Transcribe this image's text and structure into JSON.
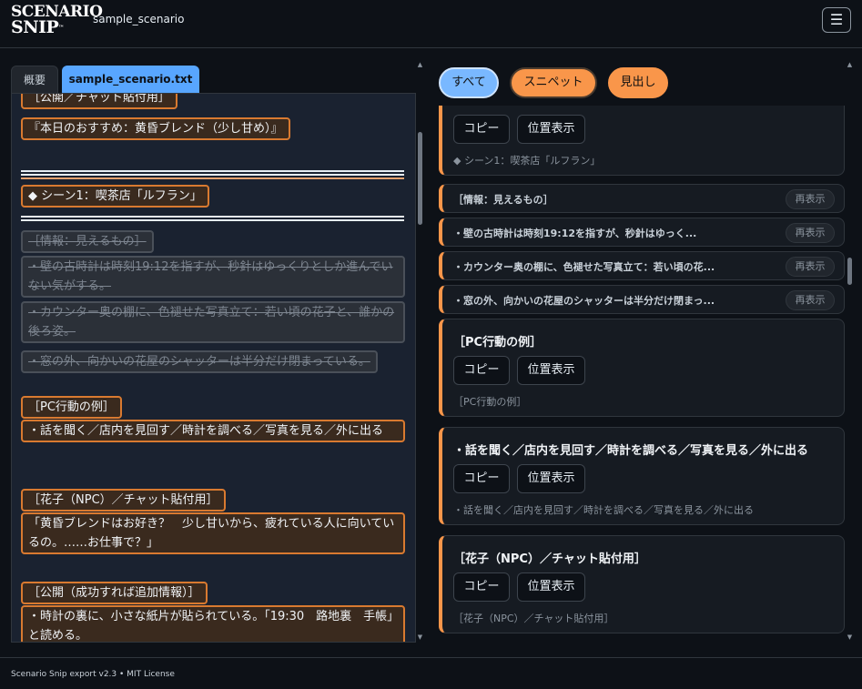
{
  "app": {
    "logo_line1": "SCENARIO",
    "logo_line2": "SNIP",
    "logo_tm": "™",
    "project_name": "sample_scenario",
    "menu_icon": "☰"
  },
  "tabs": [
    {
      "label": "概要"
    },
    {
      "label": "sample_scenario.txt"
    }
  ],
  "editor": {
    "lines": [
      "［公開／チャット貼付用］",
      "『本日のおすすめ：黄昏ブレンド（少し甘め）』",
      "◆ シーン1：喫茶店「ルフラン」",
      "［情報：見えるもの］",
      "・壁の古時計は時刻19:12を指すが、秒針はゆっくりとしか進んでいない気がする。",
      "・カウンター奥の棚に、色褪せた写真立て：若い頃の花子と、誰かの後ろ姿。",
      "・窓の外、向かいの花屋のシャッターは半分だけ閉まっている。",
      "［PC行動の例］",
      "・話を聞く／店内を見回す／時計を調べる／写真を見る／外に出る",
      "［花子（NPC）／チャット貼付用］",
      "「黄昏ブレンドはお好き？　少し甘いから、疲れている人に向いているの。……お仕事で？」",
      "［公開（成功すれば追加情報）］",
      "・時計の裏に、小さな紙片が貼られている。「19:30　路地裏　手帳」と読める。"
    ]
  },
  "filters": {
    "all": "すべて",
    "snippet": "スニペット",
    "heading": "見出し"
  },
  "cards": {
    "copy_label": "コピー",
    "locate_label": "位置表示",
    "reshow_label": "再表示",
    "scene_preview": "◆ シーン1：喫茶店「ルフラン」",
    "minis": [
      "［情報：見えるもの］",
      "・壁の古時計は時刻19:12を指すが、秒針はゆっく...",
      "・カウンター奥の棚に、色褪せた写真立て：若い頃の花...",
      "・窓の外、向かいの花屋のシャッターは半分だけ閉まっ..."
    ],
    "full": [
      {
        "title": "［PC行動の例］",
        "preview": "［PC行動の例］"
      },
      {
        "title": "・話を聞く／店内を見回す／時計を調べる／写真を見る／外に出る",
        "preview": "・話を聞く／店内を見回す／時計を調べる／写真を見る／外に出る"
      },
      {
        "title": "［花子（NPC）／チャット貼付用］",
        "preview": "［花子（NPC）／チャット貼付用］"
      }
    ]
  },
  "footer": {
    "text": "Scenario Snip export v2.3 • MIT License"
  },
  "colors": {
    "accent_blue": "#58a6ff",
    "accent_orange": "#f9964a",
    "background": "#0d1117"
  }
}
